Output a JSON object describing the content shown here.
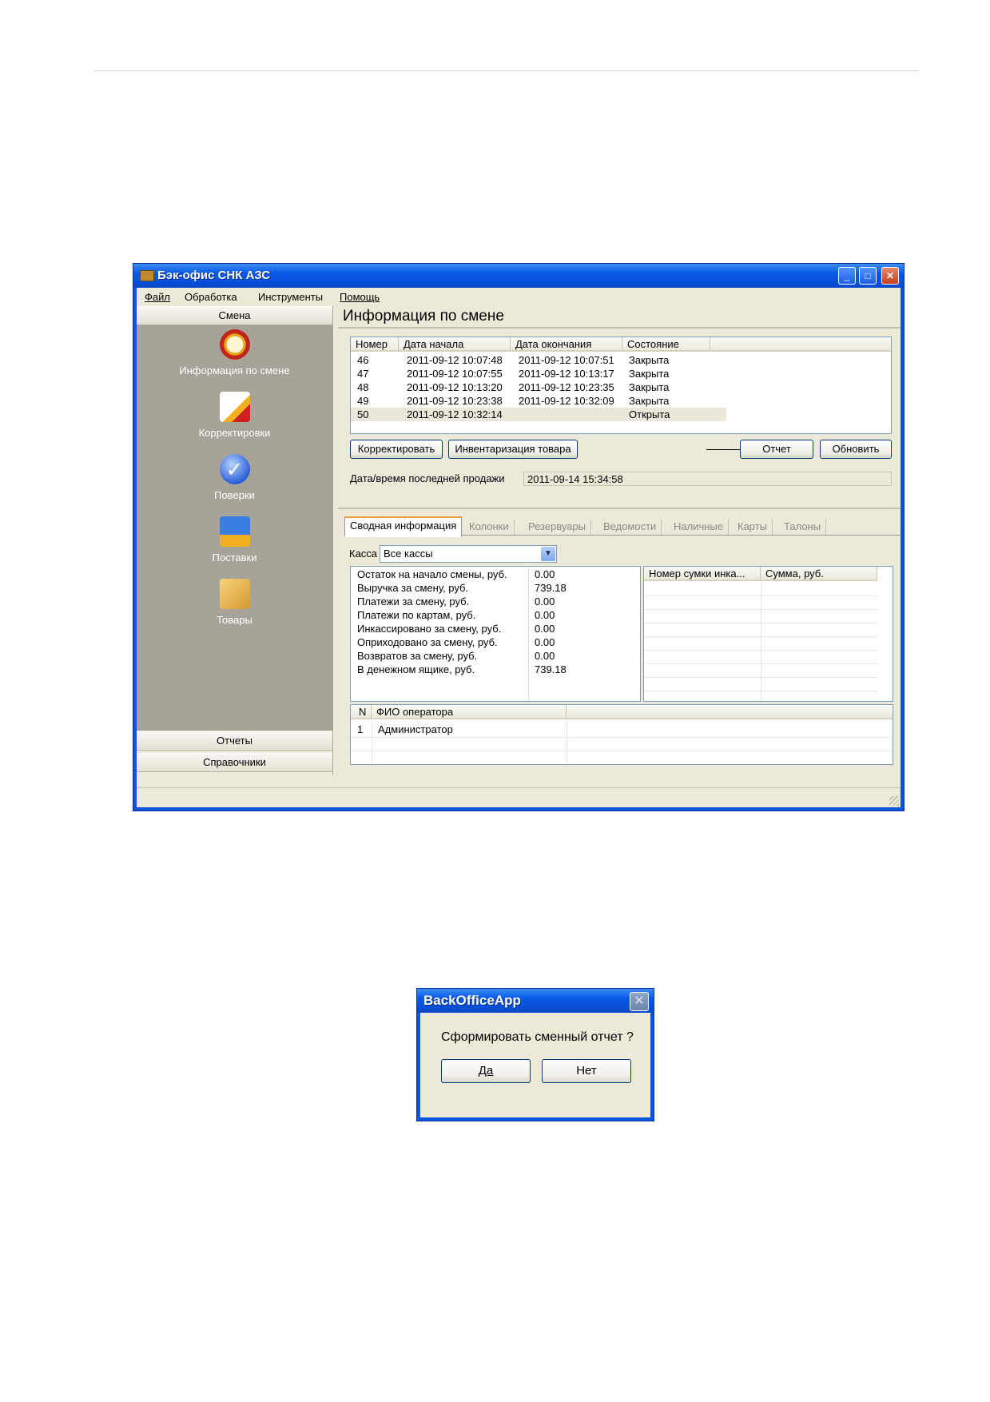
{
  "window": {
    "title": "Бэк-офис СНК АЗС",
    "menu": [
      "Файл",
      "Обработка",
      "Инструменты",
      "Помощь"
    ]
  },
  "nav": {
    "header": "Смена",
    "items": [
      {
        "label": "Информация по смене",
        "icon": "clock-icon"
      },
      {
        "label": "Корректировки",
        "icon": "edit-icon"
      },
      {
        "label": "Поверки",
        "icon": "check-icon"
      },
      {
        "label": "Поставки",
        "icon": "truck-icon"
      },
      {
        "label": "Товары",
        "icon": "box-icon"
      }
    ],
    "bottom": [
      "Отчеты",
      "Справочники"
    ]
  },
  "main": {
    "title": "Информация по смене",
    "shifts": {
      "columns": [
        "Номер",
        "Дата начала",
        "Дата окончания",
        "Состояние"
      ],
      "rows": [
        [
          "46",
          "2011-09-12 10:07:48",
          "2011-09-12 10:07:51",
          "Закрыта"
        ],
        [
          "47",
          "2011-09-12 10:07:55",
          "2011-09-12 10:13:17",
          "Закрыта"
        ],
        [
          "48",
          "2011-09-12 10:13:20",
          "2011-09-12 10:23:35",
          "Закрыта"
        ],
        [
          "49",
          "2011-09-12 10:23:38",
          "2011-09-12 10:32:09",
          "Закрыта"
        ],
        [
          "50",
          "2011-09-12 10:32:14",
          "",
          "Открыта"
        ]
      ]
    },
    "buttons": {
      "correct": "Корректировать",
      "inventory": "Инвентаризация товара",
      "report": "Отчет",
      "refresh": "Обновить"
    },
    "last_sale_label": "Дата/время последней продажи",
    "last_sale_value": "2011-09-14 15:34:58",
    "tabs": [
      "Сводная информация",
      "Колонки",
      "Резервуары",
      "Ведомости",
      "Наличные",
      "Карты",
      "Талоны"
    ],
    "kassa_label": "Касса",
    "kassa_value": "Все кассы",
    "summary": [
      [
        "Остаток на начало смены, руб.",
        "0.00"
      ],
      [
        "Выручка за смену, руб.",
        "739.18"
      ],
      [
        "Платежи за смену, руб.",
        "0.00"
      ],
      [
        "Платежи по картам, руб.",
        "0.00"
      ],
      [
        "Инкассировано за смену, руб.",
        "0.00"
      ],
      [
        "Оприходовано за смену, руб.",
        "0.00"
      ],
      [
        "Возвратов за смену, руб.",
        "0.00"
      ],
      [
        "В денежном ящике, руб.",
        "739.18"
      ]
    ],
    "bags": {
      "columns": [
        "Номер сумки инка...",
        "Сумма, руб."
      ]
    },
    "operators": {
      "columns": [
        "N",
        "ФИО оператора"
      ],
      "rows": [
        [
          "1",
          "Администратор"
        ]
      ]
    }
  },
  "dialog": {
    "title": "BackOfficeApp",
    "message": "Сформировать сменный отчет ?",
    "yes": "Да",
    "no": "Нет"
  }
}
